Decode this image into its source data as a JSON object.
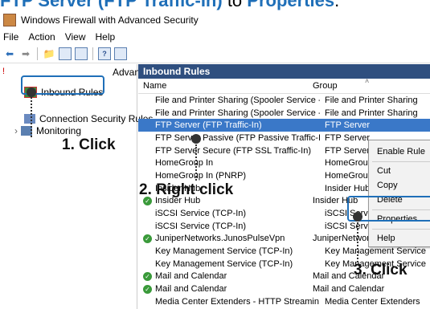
{
  "banner": {
    "part1": "FTP Server (FTP Traffic-In)",
    "part2": " to ",
    "part3": "Properties",
    "part4": "."
  },
  "window": {
    "title": "Windows Firewall with Advanced Security"
  },
  "menu": [
    "File",
    "Action",
    "View",
    "Help"
  ],
  "left_pane": {
    "header": "Advanc",
    "items": [
      {
        "label": "Inbound Rules",
        "icon": "inbound-rules-icon"
      },
      {
        "label": "Connection Security Rules",
        "icon": "connection-rules-icon"
      },
      {
        "label": "Monitoring",
        "icon": "monitoring-icon"
      }
    ]
  },
  "right_pane": {
    "header": "Inbound Rules",
    "columns": [
      "Name",
      "Group"
    ],
    "rows": [
      {
        "name": "File and Printer Sharing (Spooler Service -...",
        "group": "File and Printer Sharing",
        "enabled": false
      },
      {
        "name": "File and Printer Sharing (Spooler Service -...",
        "group": "File and Printer Sharing",
        "enabled": false
      },
      {
        "name": "FTP Server (FTP Traffic-In)",
        "group": "FTP Server",
        "enabled": false,
        "selected": true
      },
      {
        "name": "FTP Server Passive (FTP Passive Traffic-In)",
        "group": "FTP Server",
        "enabled": false
      },
      {
        "name": "FTP Server Secure (FTP SSL Traffic-In)",
        "group": "FTP Server",
        "enabled": false
      },
      {
        "name": "HomeGroup In",
        "group": "HomeGroup",
        "enabled": false
      },
      {
        "name": "HomeGroup In (PNRP)",
        "group": "HomeGroup",
        "enabled": false
      },
      {
        "name": "Insider Hub",
        "group": "Insider Hub",
        "enabled": false
      },
      {
        "name": "Insider Hub",
        "group": "Insider Hub",
        "enabled": true
      },
      {
        "name": "iSCSI Service (TCP-In)",
        "group": "iSCSI Service",
        "enabled": false
      },
      {
        "name": "iSCSI Service (TCP-In)",
        "group": "iSCSI Service",
        "enabled": false
      },
      {
        "name": "JuniperNetworks.JunosPulseVpn",
        "group": "JuniperNetworks.JunosPulse...",
        "enabled": true
      },
      {
        "name": "Key Management Service (TCP-In)",
        "group": "Key Management Service",
        "enabled": false
      },
      {
        "name": "Key Management Service (TCP-In)",
        "group": "Key Management Service",
        "enabled": false
      },
      {
        "name": "Mail and Calendar",
        "group": "Mail and Calendar",
        "enabled": true
      },
      {
        "name": "Mail and Calendar",
        "group": "Mail and Calendar",
        "enabled": true
      },
      {
        "name": "Media Center Extenders - HTTP Streamin...",
        "group": "Media Center Extenders",
        "enabled": false
      }
    ]
  },
  "context_menu": {
    "items": [
      "Enable Rule",
      "Cut",
      "Copy",
      "Delete",
      "Properties",
      "Help"
    ]
  },
  "annotations": {
    "step1": "1. Click",
    "step2": "2. Right click",
    "step3": "3. Click"
  },
  "colors": {
    "accent": "#1f6fb8",
    "header_bg": "#2f4f7f",
    "selected_row": "#3a78c8"
  }
}
